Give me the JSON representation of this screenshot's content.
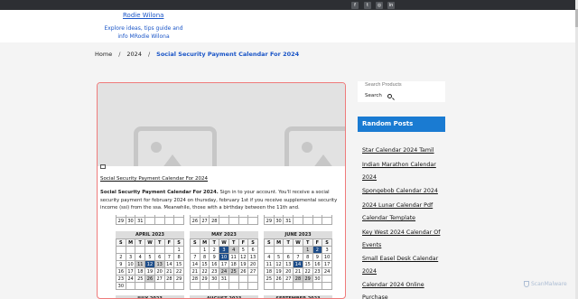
{
  "header": {
    "site_title": "Rodie Wilona",
    "tagline": "Explore ideas, tips guide and info MRodie Wilona",
    "social_icons": [
      "facebook-icon",
      "twitter-icon",
      "instagram-icon",
      "linkedin-icon"
    ]
  },
  "breadcrumb": {
    "home": "Home",
    "sep1": "/",
    "year": "2024",
    "sep2": "/",
    "current": "Social Security Payment Calendar For 2024"
  },
  "post": {
    "image_alt": "",
    "link_title": "Social Security Payment Calendar For 2024",
    "body_bold": "Social Security Payment Calendar For 2024.",
    "body_text": " Sign in to your account. You'll receive a social security payment for february 2024 on thursday, february 1st if you receive supplemental security income (ssi) from the ssa. Meanwhile, those with a birthday between the 11th and."
  },
  "calendars": {
    "partial_rows": [
      {
        "row1": [
          "18",
          "17",
          "18",
          "19",
          "20",
          "21",
          "22"
        ],
        "row2": [
          "29",
          "30",
          "31",
          "",
          "",
          "",
          ""
        ]
      },
      {
        "row1": [
          "19",
          "20",
          "21",
          "22",
          "23",
          "24",
          "25"
        ],
        "row2": [
          "26",
          "27",
          "28",
          "",
          "",
          "",
          ""
        ]
      },
      {
        "row1": [
          "19",
          "20",
          "21",
          "22",
          "23",
          "24",
          "25"
        ],
        "row2": [
          "29",
          "30",
          "31",
          "",
          "",
          "",
          ""
        ]
      }
    ],
    "weekdays": [
      "S",
      "M",
      "T",
      "W",
      "T",
      "F",
      "S"
    ],
    "april": {
      "title": "APRIL 2023",
      "rows": [
        [
          "",
          "",
          "",
          "",
          "",
          "",
          "1"
        ],
        [
          "2",
          "3",
          "4",
          "5",
          "6",
          "7",
          "8"
        ],
        [
          "9",
          "10",
          "11",
          "12",
          "13",
          "14",
          "15"
        ],
        [
          "16",
          "17",
          "18",
          "19",
          "20",
          "21",
          "22"
        ],
        [
          "23",
          "24",
          "25",
          "26",
          "27",
          "28",
          "29"
        ],
        [
          "30",
          "",
          "",
          "",
          "",
          "",
          ""
        ]
      ]
    },
    "may": {
      "title": "MAY 2023",
      "rows": [
        [
          "",
          "1",
          "2",
          "3",
          "4",
          "5",
          "6"
        ],
        [
          "7",
          "8",
          "9",
          "10",
          "11",
          "12",
          "13"
        ],
        [
          "14",
          "15",
          "16",
          "17",
          "18",
          "19",
          "20"
        ],
        [
          "21",
          "22",
          "23",
          "24",
          "25",
          "26",
          "27"
        ],
        [
          "28",
          "29",
          "30",
          "31",
          "",
          "",
          ""
        ],
        [
          "",
          "",
          "",
          "",
          "",
          "",
          ""
        ]
      ]
    },
    "june": {
      "title": "JUNE 2023",
      "rows": [
        [
          "",
          "",
          "",
          "",
          "1",
          "2",
          "3"
        ],
        [
          "4",
          "5",
          "6",
          "7",
          "8",
          "9",
          "10"
        ],
        [
          "11",
          "12",
          "13",
          "14",
          "15",
          "16",
          "17"
        ],
        [
          "18",
          "19",
          "20",
          "21",
          "22",
          "23",
          "24"
        ],
        [
          "25",
          "26",
          "27",
          "28",
          "29",
          "30",
          ""
        ],
        [
          "",
          "",
          "",
          "",
          "",
          "",
          ""
        ]
      ]
    },
    "next_titles": [
      "JULY 2023",
      "AUGUST 2023",
      "SEPTEMBER 2023"
    ]
  },
  "sidebar": {
    "search_placeholder": "Search Products",
    "search_button": "Search",
    "random_title": "Random Posts",
    "random_posts": [
      "Star Calendar 2024 Tamil",
      "Indian Marathon Calendar 2024",
      "Spongebob Calendar 2024",
      "2024 Lunar Calendar Pdf Calendar Template",
      "Key West 2024 Calendar Of Events",
      "Small Easel Desk Calendar 2024",
      "Calendar 2024 Online Purchase"
    ]
  },
  "watermark": "ScanMalware"
}
